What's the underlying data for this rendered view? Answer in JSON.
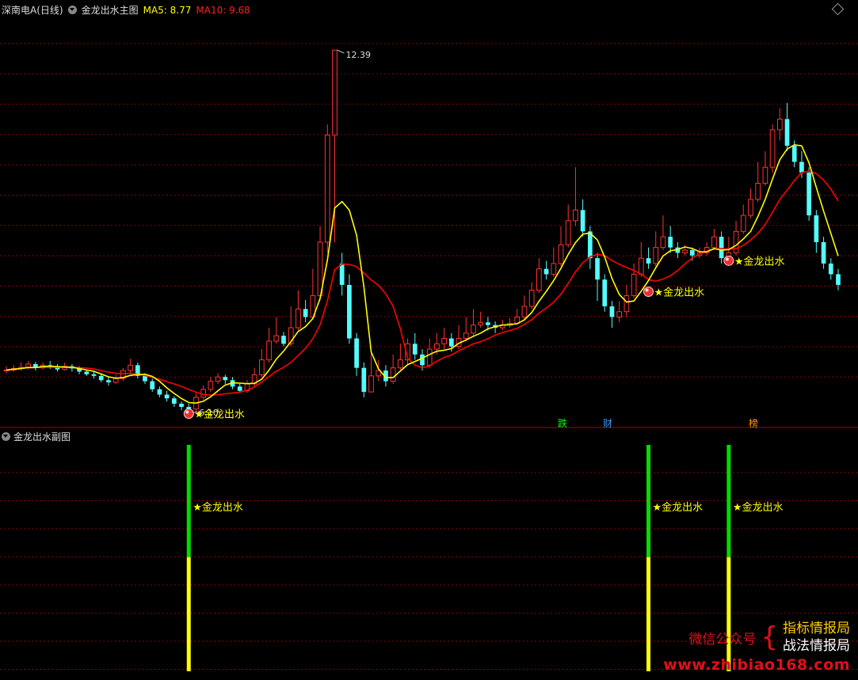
{
  "header": {
    "stock": "深南电A(日线)",
    "indicator": "金龙出水主图",
    "ma5_label": "MA5: 8.77",
    "ma10_label": "MA10: 9.68"
  },
  "subpanel": {
    "title": "金龙出水副图"
  },
  "tags": {
    "die": "跌",
    "cai": "财",
    "bang": "榜"
  },
  "watermark": {
    "left": "微信公众号",
    "brace": "{",
    "line1": "指标情报局",
    "line2": "战法情报局",
    "url": "www.zhibiao168.com"
  },
  "colors": {
    "up": "#ff3232",
    "down": "#54fcfc",
    "ma5": "#ffff00",
    "ma10": "#ff0000",
    "grid": "#8b0000",
    "green": "#00dd00",
    "yellow": "#ffff00"
  },
  "chart_data": {
    "type": "candlestick",
    "high_label": "12.39",
    "low_label": "6.10",
    "ylim": [
      5.75,
      13.0
    ],
    "ma5_last": 8.77,
    "ma10_last": 9.68,
    "signal_label": "★金龙出水",
    "sub_signal_label": "★金龙出水",
    "candles": [
      [
        6.4,
        6.41,
        6.48,
        6.35
      ],
      [
        6.41,
        6.44,
        6.5,
        6.38
      ],
      [
        6.44,
        6.46,
        6.55,
        6.4
      ],
      [
        6.46,
        6.52,
        6.58,
        6.42
      ],
      [
        6.52,
        6.45,
        6.56,
        6.4
      ],
      [
        6.45,
        6.5,
        6.55,
        6.42
      ],
      [
        6.5,
        6.47,
        6.58,
        6.43
      ],
      [
        6.47,
        6.42,
        6.52,
        6.38
      ],
      [
        6.42,
        6.48,
        6.55,
        6.4
      ],
      [
        6.48,
        6.44,
        6.52,
        6.38
      ],
      [
        6.44,
        6.38,
        6.48,
        6.33
      ],
      [
        6.38,
        6.33,
        6.42,
        6.3
      ],
      [
        6.33,
        6.3,
        6.38,
        6.25
      ],
      [
        6.3,
        6.22,
        6.34,
        6.18
      ],
      [
        6.22,
        6.18,
        6.28,
        6.12
      ],
      [
        6.18,
        6.25,
        6.32,
        6.15
      ],
      [
        6.25,
        6.4,
        6.45,
        6.2
      ],
      [
        6.4,
        6.5,
        6.62,
        6.35
      ],
      [
        6.5,
        6.3,
        6.55,
        6.25
      ],
      [
        6.3,
        6.2,
        6.35,
        6.15
      ],
      [
        6.2,
        6.05,
        6.25,
        6.0
      ],
      [
        6.05,
        5.95,
        6.1,
        5.9
      ],
      [
        5.95,
        5.88,
        6.02,
        5.82
      ],
      [
        5.88,
        5.78,
        5.92,
        5.72
      ],
      [
        5.78,
        5.72,
        5.82,
        5.66
      ],
      [
        5.72,
        5.68,
        5.78,
        5.62
      ],
      [
        5.68,
        5.9,
        5.98,
        5.62
      ],
      [
        5.9,
        6.05,
        6.12,
        5.85
      ],
      [
        6.05,
        6.2,
        6.28,
        6.0
      ],
      [
        6.2,
        6.28,
        6.35,
        6.15
      ],
      [
        6.28,
        6.22,
        6.32,
        6.15
      ],
      [
        6.22,
        6.1,
        6.28,
        6.05
      ],
      [
        6.1,
        6.02,
        6.15,
        5.98
      ],
      [
        6.02,
        6.15,
        6.22,
        5.98
      ],
      [
        6.15,
        6.32,
        6.45,
        6.1
      ],
      [
        6.32,
        6.6,
        6.8,
        6.28
      ],
      [
        6.6,
        6.95,
        7.2,
        6.55
      ],
      [
        6.95,
        7.05,
        7.4,
        6.9
      ],
      [
        7.05,
        6.9,
        7.12,
        6.85
      ],
      [
        6.9,
        7.2,
        7.6,
        6.85
      ],
      [
        7.2,
        7.55,
        7.9,
        7.15
      ],
      [
        7.55,
        7.4,
        7.72,
        7.3
      ],
      [
        7.4,
        7.8,
        8.3,
        7.35
      ],
      [
        7.8,
        8.8,
        9.1,
        7.7
      ],
      [
        8.8,
        10.8,
        11.0,
        8.6
      ],
      [
        10.8,
        12.39,
        12.39,
        8.8
      ],
      [
        8.4,
        8.0,
        8.6,
        7.8
      ],
      [
        8.0,
        7.0,
        8.2,
        6.9
      ],
      [
        7.0,
        6.45,
        7.1,
        6.3
      ],
      [
        6.45,
        6.0,
        6.55,
        5.9
      ],
      [
        6.0,
        6.3,
        6.8,
        6.1
      ],
      [
        6.3,
        6.4,
        6.6,
        6.2
      ],
      [
        6.4,
        6.2,
        6.5,
        6.1
      ],
      [
        6.2,
        6.45,
        6.7,
        6.15
      ],
      [
        6.45,
        6.6,
        6.9,
        6.4
      ],
      [
        6.6,
        6.9,
        7.0,
        6.5
      ],
      [
        6.9,
        6.7,
        7.1,
        6.6
      ],
      [
        6.7,
        6.5,
        6.8,
        6.4
      ],
      [
        6.5,
        6.8,
        7.0,
        6.45
      ],
      [
        6.8,
        6.9,
        7.1,
        6.7
      ],
      [
        6.9,
        7.0,
        7.2,
        6.8
      ],
      [
        7.0,
        6.85,
        7.1,
        6.75
      ],
      [
        6.85,
        7.0,
        7.25,
        6.8
      ],
      [
        7.0,
        7.1,
        7.4,
        6.95
      ],
      [
        7.1,
        7.25,
        7.55,
        7.05
      ],
      [
        7.25,
        7.3,
        7.5,
        7.2
      ],
      [
        7.3,
        7.25,
        7.4,
        7.15
      ],
      [
        7.25,
        7.2,
        7.32,
        7.1
      ],
      [
        7.2,
        7.25,
        7.35,
        7.15
      ],
      [
        7.25,
        7.28,
        7.38,
        7.2
      ],
      [
        7.28,
        7.4,
        7.55,
        7.25
      ],
      [
        7.4,
        7.6,
        7.8,
        7.35
      ],
      [
        7.6,
        7.9,
        8.05,
        7.55
      ],
      [
        7.9,
        8.3,
        8.5,
        7.85
      ],
      [
        8.3,
        8.2,
        8.45,
        8.1
      ],
      [
        8.2,
        8.4,
        8.7,
        8.15
      ],
      [
        8.4,
        8.75,
        9.1,
        8.35
      ],
      [
        8.75,
        9.2,
        9.5,
        8.7
      ],
      [
        9.2,
        9.4,
        10.2,
        9.1
      ],
      [
        9.4,
        9.0,
        9.6,
        8.9
      ],
      [
        9.0,
        8.5,
        9.1,
        8.3
      ],
      [
        8.5,
        8.1,
        8.6,
        7.7
      ],
      [
        8.1,
        7.6,
        8.2,
        7.5
      ],
      [
        7.6,
        7.4,
        7.7,
        7.2
      ],
      [
        7.4,
        7.5,
        7.7,
        7.3
      ],
      [
        7.5,
        7.8,
        8.0,
        7.4
      ],
      [
        7.8,
        8.2,
        8.4,
        7.75
      ],
      [
        8.2,
        8.5,
        8.8,
        8.15
      ],
      [
        8.5,
        8.4,
        8.7,
        8.3
      ],
      [
        8.4,
        8.7,
        9.0,
        8.35
      ],
      [
        8.7,
        8.9,
        9.3,
        8.65
      ],
      [
        8.9,
        8.7,
        9.1,
        8.6
      ],
      [
        8.7,
        8.6,
        8.8,
        8.5
      ],
      [
        8.6,
        8.65,
        8.75,
        8.55
      ],
      [
        8.65,
        8.55,
        8.7,
        8.45
      ],
      [
        8.55,
        8.6,
        8.7,
        8.5
      ],
      [
        8.6,
        8.7,
        8.8,
        8.55
      ],
      [
        8.7,
        8.9,
        9.05,
        8.65
      ],
      [
        8.9,
        8.5,
        9.0,
        8.4
      ],
      [
        8.5,
        8.6,
        8.9,
        8.45
      ],
      [
        8.6,
        9.0,
        9.2,
        8.55
      ],
      [
        9.0,
        9.3,
        9.5,
        8.95
      ],
      [
        9.3,
        9.6,
        9.8,
        9.25
      ],
      [
        9.6,
        9.9,
        10.3,
        9.55
      ],
      [
        9.9,
        10.2,
        10.5,
        9.85
      ],
      [
        10.2,
        10.9,
        11.0,
        10.1
      ],
      [
        10.9,
        11.1,
        11.3,
        10.7
      ],
      [
        11.1,
        10.6,
        11.4,
        10.5
      ],
      [
        10.6,
        10.3,
        10.7,
        10.2
      ],
      [
        10.3,
        10.1,
        10.5,
        10.0
      ],
      [
        10.1,
        9.3,
        10.2,
        9.2
      ],
      [
        9.3,
        8.8,
        9.4,
        8.6
      ],
      [
        8.8,
        8.4,
        8.9,
        8.3
      ],
      [
        8.4,
        8.2,
        8.5,
        8.1
      ],
      [
        8.2,
        8.0,
        8.3,
        7.9
      ]
    ]
  }
}
